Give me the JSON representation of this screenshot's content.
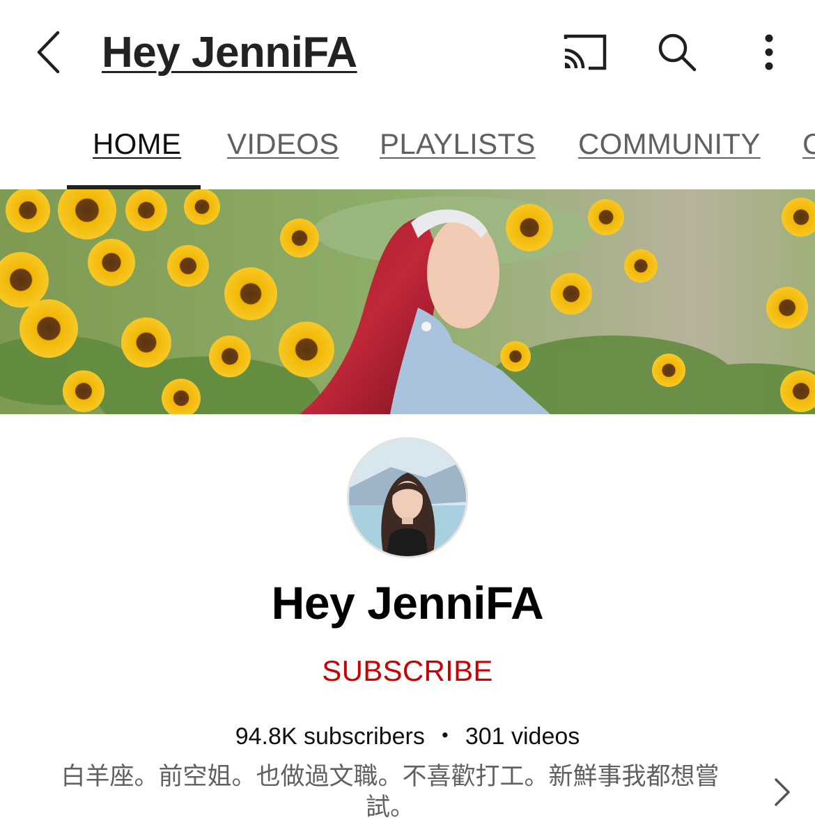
{
  "appbar": {
    "title": "Hey JenniFA",
    "icons": [
      "back-chevron-icon",
      "cast-icon",
      "search-icon",
      "more-vert-icon"
    ]
  },
  "tabs": [
    {
      "label": "HOME",
      "active": true
    },
    {
      "label": "VIDEOS",
      "active": false
    },
    {
      "label": "PLAYLISTS",
      "active": false
    },
    {
      "label": "COMMUNITY",
      "active": false
    },
    {
      "label": "C",
      "active": false
    }
  ],
  "channel": {
    "name": "Hey JenniFA",
    "subscribe_label": "SUBSCRIBE",
    "subscribers": "94.8K subscribers",
    "separator": "・",
    "videos": "301 videos",
    "description": "白羊座。前空姐。也做過文職。不喜歡打工。新鮮事我都想嘗試。"
  },
  "colors": {
    "subscribe": "#cc0000",
    "tab_indicator": "#212121",
    "secondary_text": "#606060"
  }
}
